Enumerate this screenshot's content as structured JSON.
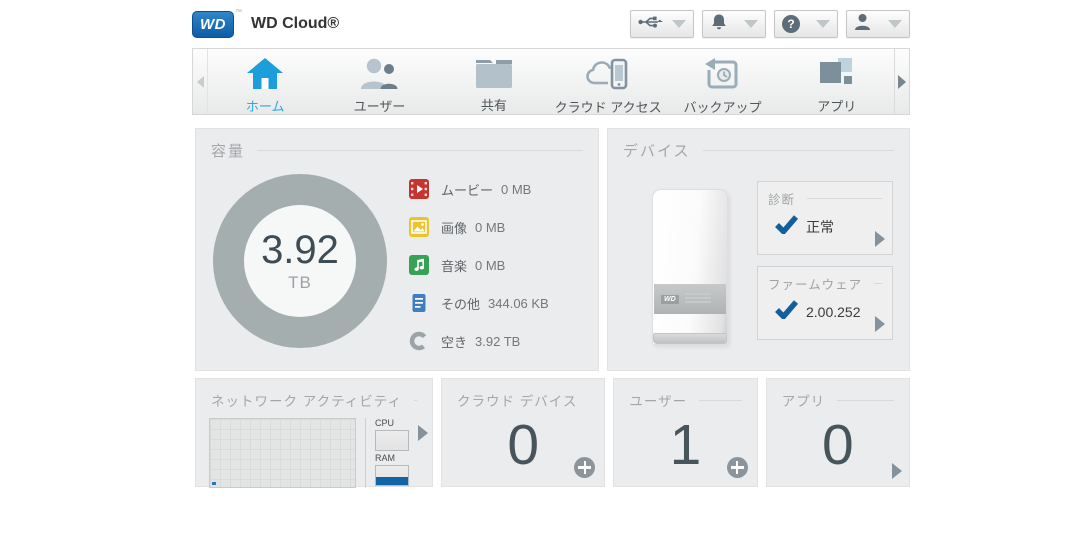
{
  "header": {
    "logo": "WD",
    "logo_tm": "™",
    "title": "WD Cloud®",
    "buttons": [
      {
        "name": "usb",
        "icon": "usb-icon"
      },
      {
        "name": "alerts",
        "icon": "bell-icon"
      },
      {
        "name": "help",
        "icon": "help-icon",
        "glyph": "?"
      },
      {
        "name": "user",
        "icon": "user-icon"
      }
    ]
  },
  "nav": {
    "items": [
      {
        "label": "ホーム",
        "icon": "home-icon",
        "active": true
      },
      {
        "label": "ユーザー",
        "icon": "users-icon",
        "active": false
      },
      {
        "label": "共有",
        "icon": "shares-icon",
        "active": false
      },
      {
        "label": "クラウド アクセス",
        "icon": "cloud-access-icon",
        "active": false
      },
      {
        "label": "バックアップ",
        "icon": "backup-icon",
        "active": false
      },
      {
        "label": "アプリ",
        "icon": "apps-icon",
        "active": false
      }
    ]
  },
  "capacity": {
    "title": "容量",
    "donut": {
      "value": "3.92",
      "unit": "TB"
    },
    "legend": [
      {
        "label": "ムービー",
        "value": "0 MB",
        "icon": "movie-icon",
        "color": "#c5342d"
      },
      {
        "label": "画像",
        "value": "0 MB",
        "icon": "image-icon",
        "color": "#eec32a"
      },
      {
        "label": "音楽",
        "value": "0 MB",
        "icon": "music-icon",
        "color": "#37a156"
      },
      {
        "label": "その他",
        "value": "344.06 KB",
        "icon": "document-icon",
        "color": "#3f7fc1"
      },
      {
        "label": "空き",
        "value": "3.92 TB",
        "icon": "free-space-icon",
        "color": "#9aa3a6"
      }
    ]
  },
  "device": {
    "title": "デバイス",
    "device_label_logo": "WD",
    "diagnosis": {
      "title": "診断",
      "status": "正常"
    },
    "firmware": {
      "title": "ファームウェア",
      "version": "2.00.252"
    }
  },
  "network": {
    "title": "ネットワーク アクティビティ",
    "cpu_label": "CPU",
    "ram_label": "RAM",
    "ram_usage_fraction": 0.38
  },
  "cloud_devices": {
    "title": "クラウド デバイス",
    "count": "0"
  },
  "users": {
    "title": "ユーザー",
    "count": "1"
  },
  "apps": {
    "title": "アプリ",
    "count": "0"
  },
  "colors": {
    "accent_blue": "#29abe2",
    "check_blue": "#11609b",
    "ring_gray": "#a5aeae",
    "count_text": "#47545c"
  },
  "chart_data": {
    "type": "pie",
    "title": "容量",
    "center_label": "3.92 TB",
    "slices": [
      {
        "label": "ムービー",
        "value_text": "0 MB",
        "color": "#c5342d"
      },
      {
        "label": "画像",
        "value_text": "0 MB",
        "color": "#eec32a"
      },
      {
        "label": "音楽",
        "value_text": "0 MB",
        "color": "#37a156"
      },
      {
        "label": "その他",
        "value_text": "344.06 KB",
        "color": "#3f7fc1"
      },
      {
        "label": "空き",
        "value_text": "3.92 TB",
        "color": "#a5aeae"
      }
    ]
  }
}
